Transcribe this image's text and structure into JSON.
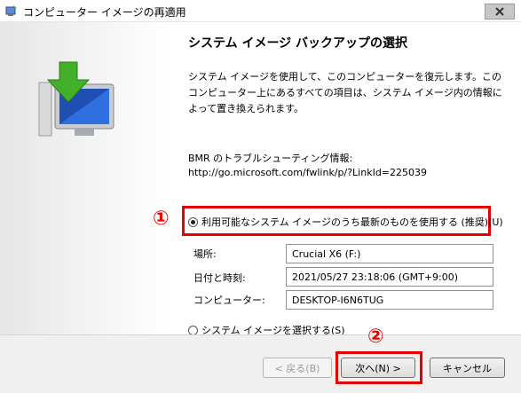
{
  "window": {
    "title": "コンピューター イメージの再適用"
  },
  "heading": "システム イメージ バックアップの選択",
  "description": "システム イメージを使用して、このコンピューターを復元します。このコンピューター上にあるすべての項目は、システム イメージ内の情報によって置き換えられます。",
  "bmr": {
    "label": "BMR のトラブルシューティング情報:",
    "url": "http://go.microsoft.com/fwlink/p/?LinkId=225039"
  },
  "options": {
    "latest": "利用可能なシステム イメージのうち最新のものを使用する (推奨)(U)",
    "select": "システム イメージを選択する(S)"
  },
  "fields": {
    "location_label": "場所:",
    "location_value": "Crucial X6 (F:)",
    "datetime_label": "日付と時刻:",
    "datetime_value": "2021/05/27 23:18:06 (GMT+9:00)",
    "computer_label": "コンピューター:",
    "computer_value": "DESKTOP-I6N6TUG"
  },
  "annotations": {
    "one": "①",
    "two": "②"
  },
  "buttons": {
    "back": "< 戻る(B)",
    "next": "次へ(N) >",
    "cancel": "キャンセル"
  },
  "colors": {
    "annotation": "#e60000"
  }
}
